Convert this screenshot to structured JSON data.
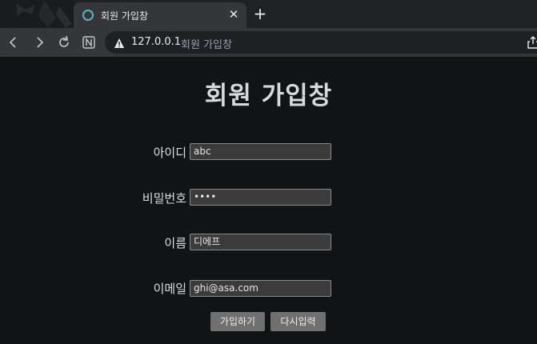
{
  "browser": {
    "tab": {
      "title": "회원 가입창",
      "close_glyph": "✕"
    },
    "new_tab_glyph": "+",
    "address_bar": {
      "host": "127.0.0.1",
      "page_title": "회원 가입창"
    },
    "icons": [
      "back-icon",
      "forward-icon",
      "reload-icon",
      "notion-icon",
      "warning-icon",
      "share-icon"
    ]
  },
  "page": {
    "title": "회원 가입창",
    "form": {
      "fields": [
        {
          "label": "아이디",
          "value": "abc",
          "type": "text"
        },
        {
          "label": "비밀번호",
          "value": "••••",
          "type": "password"
        },
        {
          "label": "이름",
          "value": "디에프",
          "type": "text"
        },
        {
          "label": "이메일",
          "value": "ghi@asa.com",
          "type": "email"
        }
      ],
      "submit_label": "가입하기",
      "reset_label": "다시입력"
    }
  },
  "colors": {
    "page_bg": "#121315",
    "tab_bg": "#35363a",
    "input_bg": "#3b3b3b",
    "button_bg": "#707070",
    "favicon": "#5fb3c4"
  }
}
